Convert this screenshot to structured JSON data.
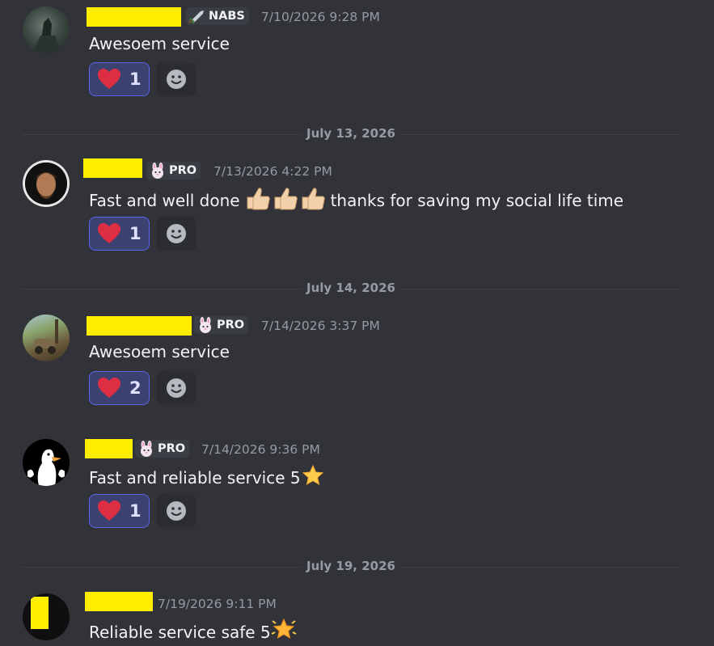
{
  "messages": [
    {
      "badge": "NABS",
      "badge_icon": "sword-icon",
      "timestamp": "7/10/2026 9:28 PM",
      "text": "Awesoem service",
      "reaction": {
        "emoji": "heart",
        "count": "1"
      }
    },
    {
      "badge": "PRO",
      "badge_icon": "bunny-icon",
      "timestamp": "7/13/2026 4:22 PM",
      "text_before": "Fast and well done",
      "text_after": "thanks for saving my social life time",
      "reaction": {
        "emoji": "heart",
        "count": "1"
      }
    },
    {
      "badge": "PRO",
      "badge_icon": "bunny-icon",
      "timestamp": "7/14/2026 3:37 PM",
      "text": "Awesoem service",
      "reaction": {
        "emoji": "heart",
        "count": "2"
      }
    },
    {
      "badge": "PRO",
      "badge_icon": "bunny-icon",
      "timestamp": "7/14/2026 9:36 PM",
      "text": "Fast and reliable service 5",
      "reaction": {
        "emoji": "heart",
        "count": "1"
      }
    },
    {
      "timestamp": "7/19/2026 9:11 PM",
      "text": "Reliable service safe 5"
    }
  ],
  "dividers": [
    "July 13, 2026",
    "July 14, 2026",
    "July 19, 2026"
  ],
  "colors": {
    "background": "#313338",
    "accent": "#5865f2",
    "redaction": "#ffee00",
    "heart": "#dd2e44"
  }
}
